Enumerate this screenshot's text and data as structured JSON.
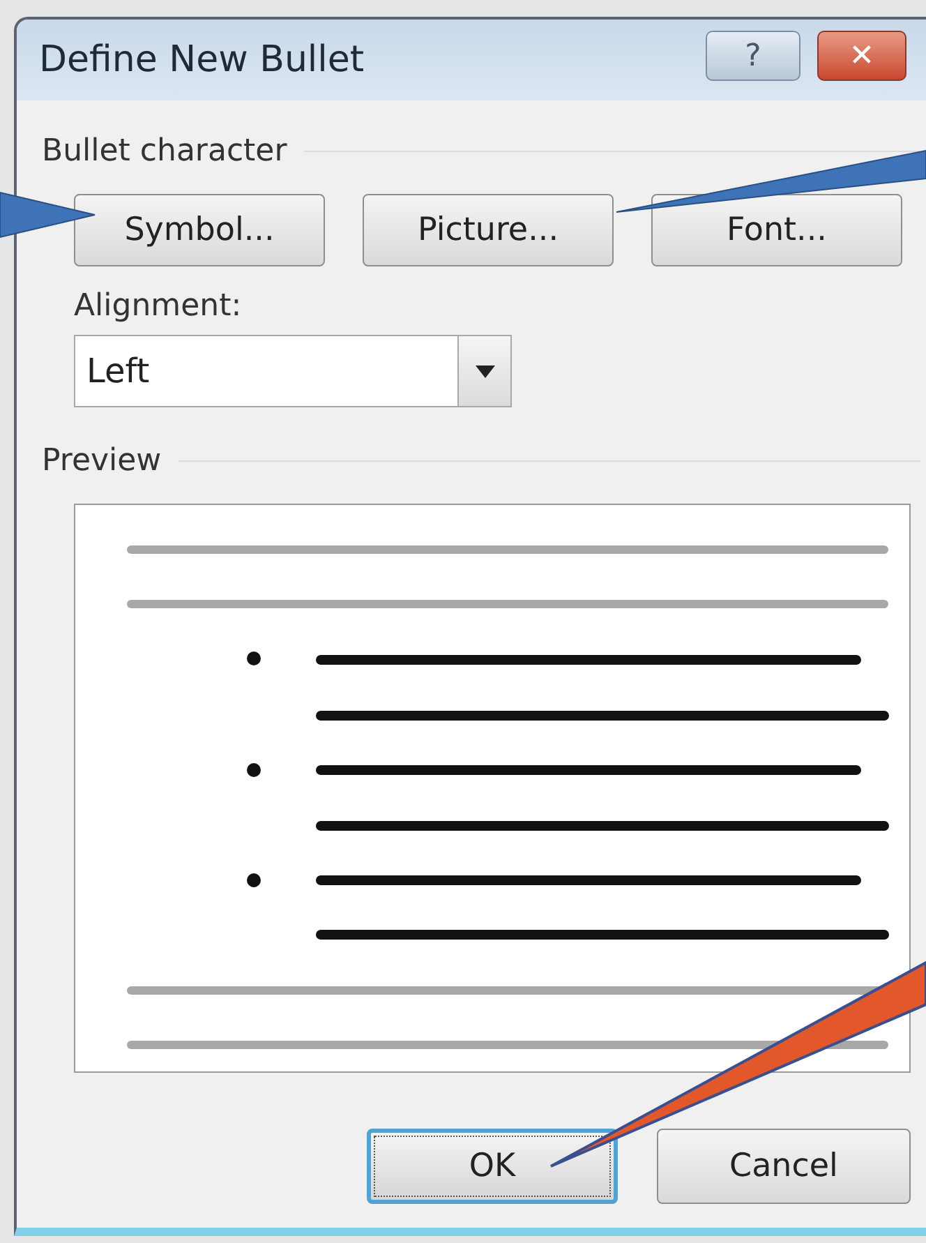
{
  "window": {
    "title": "Define New Bullet",
    "help": "?",
    "close": "✕"
  },
  "bullet_character": {
    "label": "Bullet character",
    "buttons": [
      "Symbol...",
      "Picture...",
      "Font..."
    ]
  },
  "alignment": {
    "label": "Alignment:",
    "value": "Left"
  },
  "preview": {
    "label": "Preview"
  },
  "buttons": [
    {
      "label": "OK",
      "focused": true
    },
    {
      "label": "Cancel",
      "focused": false
    }
  ]
}
